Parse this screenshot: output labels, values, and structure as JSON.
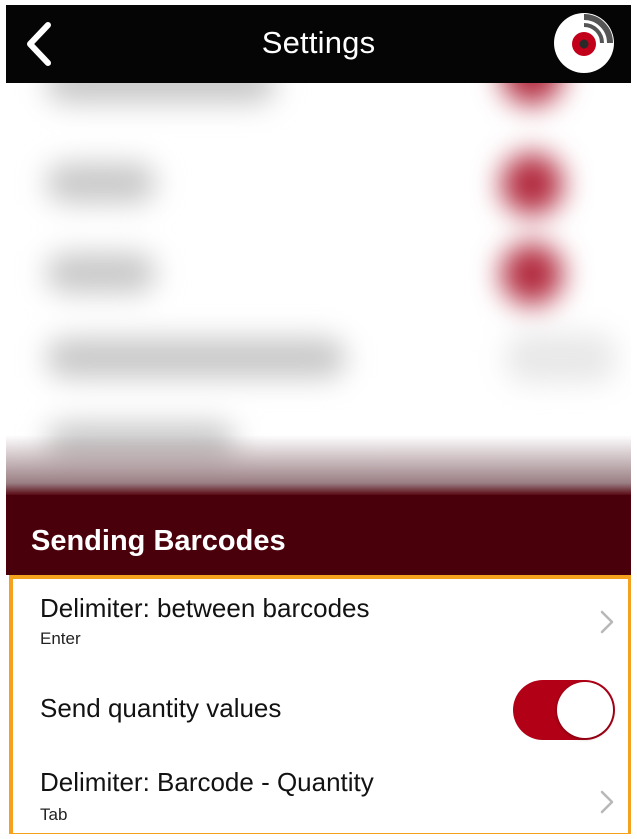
{
  "header": {
    "title": "Settings",
    "back_icon": "chevron-left-icon",
    "logo_icon": "app-logo-icon"
  },
  "section": {
    "title": "Sending Barcodes"
  },
  "settings": [
    {
      "title": "Delimiter: between barcodes",
      "value": "Enter",
      "control": "chevron-right-icon"
    },
    {
      "title": "Send quantity values",
      "toggle_on": true
    },
    {
      "title": "Delimiter: Barcode - Quantity",
      "value": "Tab",
      "control": "chevron-right-icon"
    }
  ],
  "colors": {
    "header_bg": "#050505",
    "section_bg": "#4a000b",
    "accent_red": "#b20016",
    "highlight_border": "#f4a21d"
  }
}
